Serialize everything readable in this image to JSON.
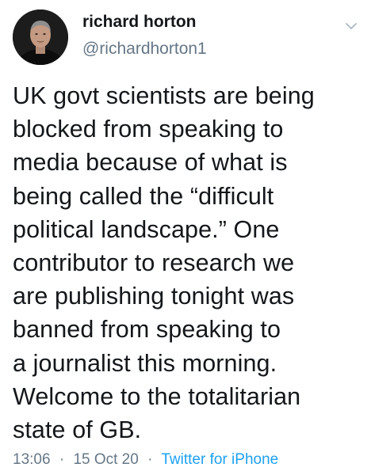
{
  "author": {
    "name": "richard horton",
    "handle": "@richardhorton1"
  },
  "tweet": {
    "lines": [
      "UK govt scientists are being",
      "blocked from speaking to",
      "media because of what is",
      "being called the “difficult",
      "political landscape.” One",
      "contributor to research we",
      "are publishing tonight was",
      "banned from speaking to",
      "a journalist this morning.",
      "Welcome to the totalitarian",
      "state of GB."
    ]
  },
  "meta": {
    "time": "13:06",
    "separator": "·",
    "date": "15 Oct 20",
    "source": "Twitter for iPhone"
  },
  "icons": {
    "menu": "chevron-down-icon"
  },
  "colors": {
    "text": "#14171a",
    "secondary": "#657786",
    "link": "#1da1f2"
  }
}
